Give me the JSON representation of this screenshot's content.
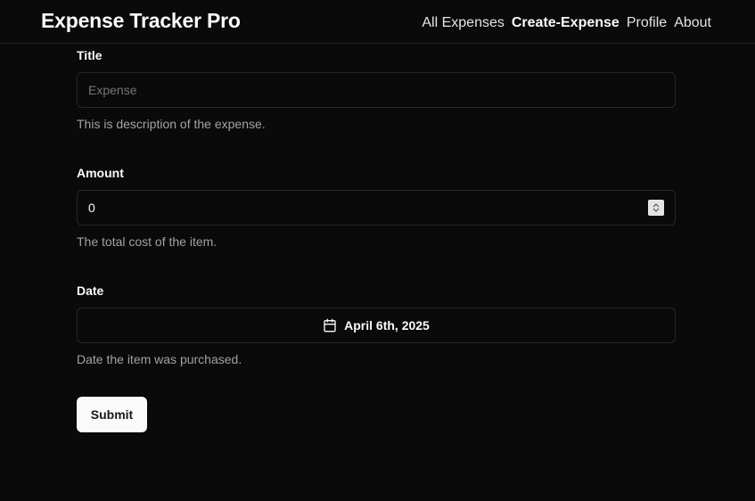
{
  "app": {
    "title": "Expense Tracker Pro"
  },
  "nav": {
    "items": [
      {
        "label": "All Expenses",
        "active": false
      },
      {
        "label": "Create-Expense",
        "active": true
      },
      {
        "label": "Profile",
        "active": false
      },
      {
        "label": "About",
        "active": false
      }
    ]
  },
  "form": {
    "title": {
      "label": "Title",
      "placeholder": "Expense",
      "value": "",
      "description": "This is description of the expense."
    },
    "amount": {
      "label": "Amount",
      "value": "0",
      "description": "The total cost of the item."
    },
    "date": {
      "label": "Date",
      "value": "April 6th, 2025",
      "icon": "calendar-icon",
      "description": "Date the item was purchased."
    },
    "submit_label": "Submit"
  },
  "colors": {
    "background": "#0a0a0a",
    "border": "#27272a",
    "text": "#fafafa",
    "muted": "#a1a1aa",
    "button_bg": "#fafafa",
    "button_text": "#18181b"
  }
}
